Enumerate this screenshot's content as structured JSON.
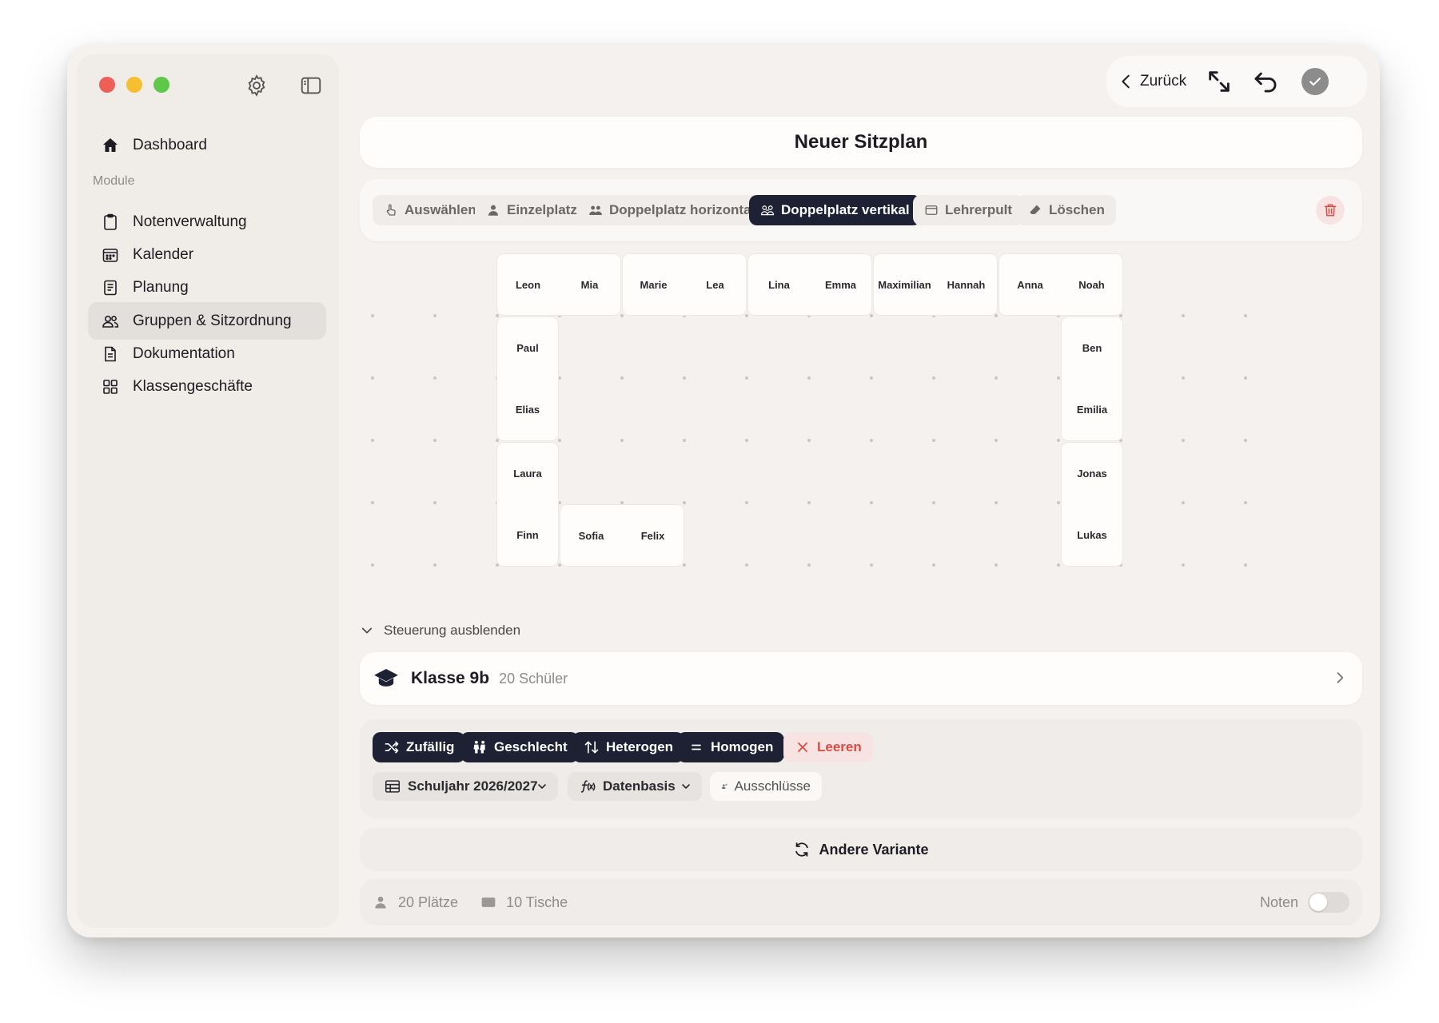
{
  "sidebar": {
    "dashboard": "Dashboard",
    "module_label": "Module",
    "items": [
      {
        "label": "Notenverwaltung"
      },
      {
        "label": "Kalender"
      },
      {
        "label": "Planung"
      },
      {
        "label": "Gruppen & Sitzordnung"
      },
      {
        "label": "Dokumentation"
      },
      {
        "label": "Klassengeschäfte"
      }
    ]
  },
  "topbar": {
    "back": "Zurück"
  },
  "title": "Neuer Sitzplan",
  "tools": {
    "select": "Auswählen",
    "single": "Einzelplatz",
    "double_h": "Doppelplatz horizontal",
    "double_v": "Doppelplatz vertikal",
    "teacher": "Lehrerpult",
    "delete": "Löschen"
  },
  "seats": {
    "top": [
      [
        "Leon",
        "Mia"
      ],
      [
        "Marie",
        "Lea"
      ],
      [
        "Lina",
        "Emma"
      ],
      [
        "Maximilian",
        "Hannah"
      ],
      [
        "Anna",
        "Noah"
      ]
    ],
    "left": [
      [
        "Paul",
        "Elias"
      ],
      [
        "Laura",
        "Finn"
      ]
    ],
    "right": [
      [
        "Ben",
        "Emilia"
      ],
      [
        "Jonas",
        "Lukas"
      ]
    ],
    "bottom": [
      [
        "Sofia",
        "Felix"
      ]
    ]
  },
  "toggle_controls": "Steuerung ausblenden",
  "class": {
    "name": "Klasse 9b",
    "count": "20 Schüler"
  },
  "controls": {
    "random": "Zufällig",
    "gender": "Geschlecht",
    "heterogeneous": "Heterogen",
    "homogeneous": "Homogen",
    "clear": "Leeren",
    "year": "Schuljahr 2026/2027",
    "database": "Datenbasis",
    "exclusions": "Ausschlüsse"
  },
  "variant": "Andere Variante",
  "status": {
    "places": "20 Plätze",
    "tables": "10 Tische",
    "grades": "Noten"
  },
  "colors": {
    "accent_dark": "#1e2133",
    "danger": "#e04a42",
    "background": "#f4f1ee"
  }
}
